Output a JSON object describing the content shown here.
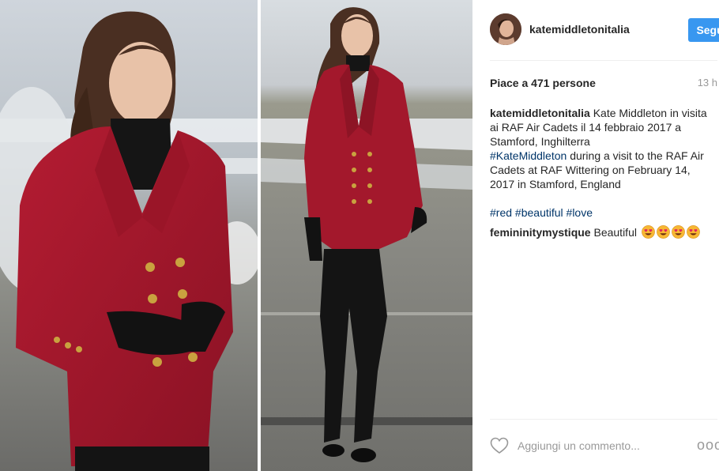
{
  "post": {
    "username": "katemiddletonitalia",
    "follow_label": "Segui",
    "likes_text": "Piace a 471 persone",
    "time": "13 h",
    "caption": {
      "author": "katemiddletonitalia",
      "text_it": "Kate Middleton in visita ai RAF Air Cadets il 14 febbraio 2017 a Stamford, Inghilterra",
      "mention": "#KateMiddleton",
      "text_en": "during a visit to the RAF Air Cadets at RAF Wittering on February 14, 2017 in Stamford, England"
    },
    "hashtags": [
      "#red",
      "#beautiful",
      "#love"
    ],
    "comment": {
      "author": "femininitymystique",
      "text": "Beautiful",
      "emoji_icon": "heart-eyes-emoji",
      "emoji_count": 4
    },
    "add_comment_placeholder": "Aggiungi un commento...",
    "more_label": "ooo"
  },
  "colors": {
    "follow_button": "#3897f0",
    "hashtag_link": "#003569",
    "jacket_red": "#a3182c",
    "meta_grey": "#999999"
  },
  "icons": {
    "like": "heart-outline-icon",
    "more": "ellipsis-icon"
  }
}
